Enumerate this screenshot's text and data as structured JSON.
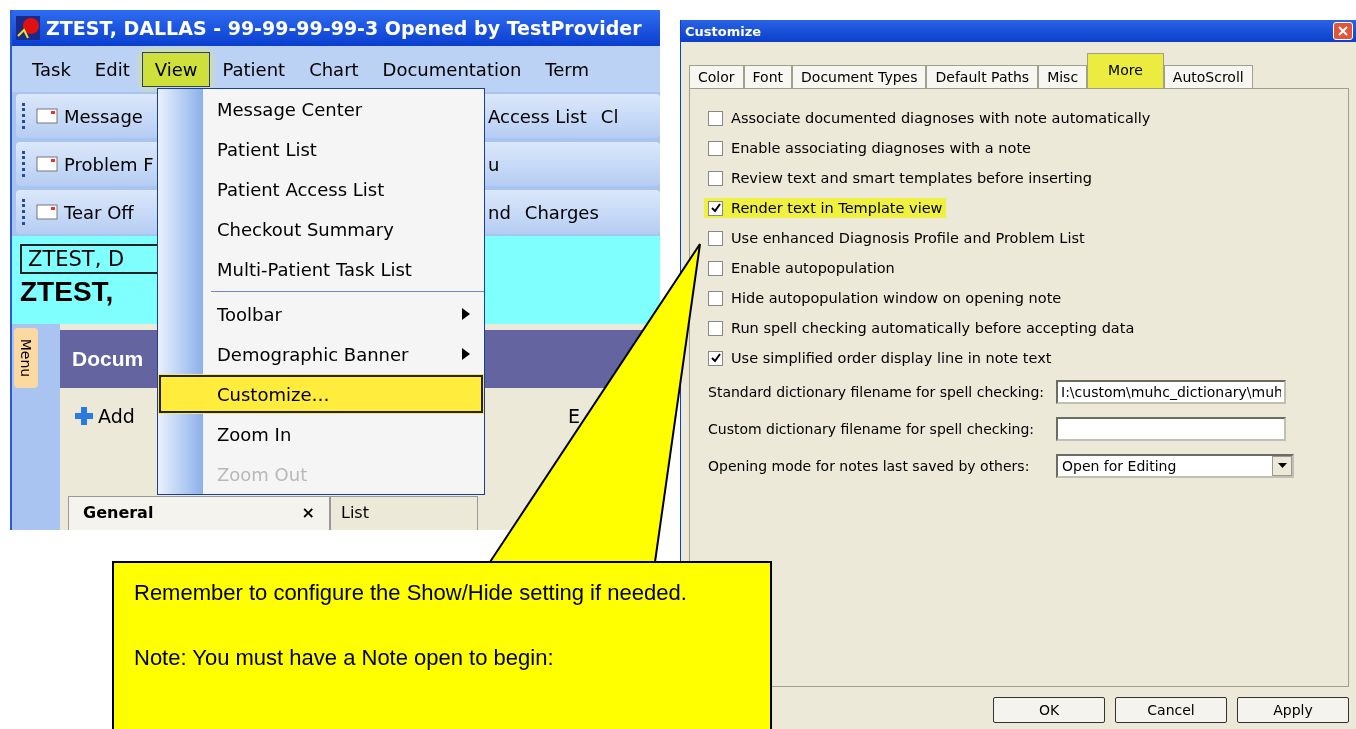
{
  "app": {
    "title": "ZTEST, DALLAS - 99-99-99-99-3 Opened by TestProvider",
    "menu": [
      {
        "label": "Task",
        "selected": false
      },
      {
        "label": "Edit",
        "selected": false
      },
      {
        "label": "View",
        "selected": true
      },
      {
        "label": "Patient",
        "selected": false
      },
      {
        "label": "Chart",
        "selected": false
      },
      {
        "label": "Documentation",
        "selected": false
      },
      {
        "label": "Term",
        "selected": false
      }
    ],
    "toolbars": [
      {
        "left": "Message",
        "right": [
          "Access List",
          "Cl"
        ]
      },
      {
        "left": "Problem F",
        "right": [
          "u"
        ]
      },
      {
        "left": "Tear Off",
        "right": [
          "nd",
          "Charges"
        ]
      }
    ],
    "patient_field": "ZTEST, D",
    "banner_name": "ZTEST,",
    "side_tab": "Menu",
    "panel_title": "Docum",
    "add_button": "Add",
    "toolbar_letter": "E",
    "doc_tabs": [
      {
        "label": "General",
        "close": "×",
        "selected": true
      },
      {
        "label": "List",
        "selected": false
      }
    ]
  },
  "view_menu": [
    {
      "kind": "item",
      "label": "Message Center",
      "selected": false,
      "disabled": false
    },
    {
      "kind": "item",
      "label": "Patient List",
      "selected": false,
      "disabled": false
    },
    {
      "kind": "item",
      "label": "Patient Access List",
      "selected": false,
      "disabled": false
    },
    {
      "kind": "item",
      "label": "Checkout Summary",
      "selected": false,
      "disabled": false
    },
    {
      "kind": "item",
      "label": "Multi-Patient Task List",
      "selected": false,
      "disabled": false
    },
    {
      "kind": "separator"
    },
    {
      "kind": "submenu",
      "label": "Toolbar",
      "selected": false,
      "disabled": false
    },
    {
      "kind": "submenu",
      "label": "Demographic Banner",
      "selected": false,
      "disabled": false
    },
    {
      "kind": "item",
      "label": "Customize…",
      "selected": true,
      "disabled": false
    },
    {
      "kind": "item",
      "label": "Zoom In",
      "selected": false,
      "disabled": false
    },
    {
      "kind": "item",
      "label": "Zoom Out",
      "selected": false,
      "disabled": true
    }
  ],
  "dialog": {
    "title": "Customize",
    "tabs": [
      {
        "label": "Color",
        "selected": false
      },
      {
        "label": "Font",
        "selected": false
      },
      {
        "label": "Document Types",
        "selected": false
      },
      {
        "label": "Default Paths",
        "selected": false
      },
      {
        "label": "Misc",
        "selected": false
      },
      {
        "label": "More",
        "selected": true
      },
      {
        "label": "AutoScroll",
        "selected": false
      }
    ],
    "options": [
      {
        "label": "Associate documented diagnoses with note automatically",
        "checked": false,
        "highlighted": false
      },
      {
        "label": "Enable associating diagnoses with a note",
        "checked": false,
        "highlighted": false
      },
      {
        "label": "Review text and smart templates before inserting",
        "checked": false,
        "highlighted": false
      },
      {
        "label": "Render text in Template view",
        "checked": true,
        "highlighted": true
      },
      {
        "label": "Use enhanced Diagnosis Profile and Problem List",
        "checked": false,
        "highlighted": false
      },
      {
        "label": "Enable autopopulation",
        "checked": false,
        "highlighted": false
      },
      {
        "label": "Hide autopopulation window on opening note",
        "checked": false,
        "highlighted": false
      },
      {
        "label": "Run spell checking automatically before accepting data",
        "checked": false,
        "highlighted": false
      },
      {
        "label": "Use simplified order display line in note text",
        "checked": true,
        "highlighted": false
      }
    ],
    "fields": [
      {
        "kind": "text",
        "label": "Standard dictionary filename for spell checking:",
        "value": "I:\\custom\\muhc_dictionary\\muh"
      },
      {
        "kind": "text",
        "label": "Custom dictionary filename for spell checking:"
      },
      {
        "kind": "dropdown",
        "label": "Opening mode for notes last saved by others:",
        "value": "Open for Editing"
      }
    ],
    "buttons": [
      "OK",
      "Cancel",
      "Apply"
    ]
  },
  "callout": {
    "paragraphs": [
      "Remember to configure the Show/Hide setting if needed.",
      "Note: You must have a Note open to begin:"
    ]
  }
}
